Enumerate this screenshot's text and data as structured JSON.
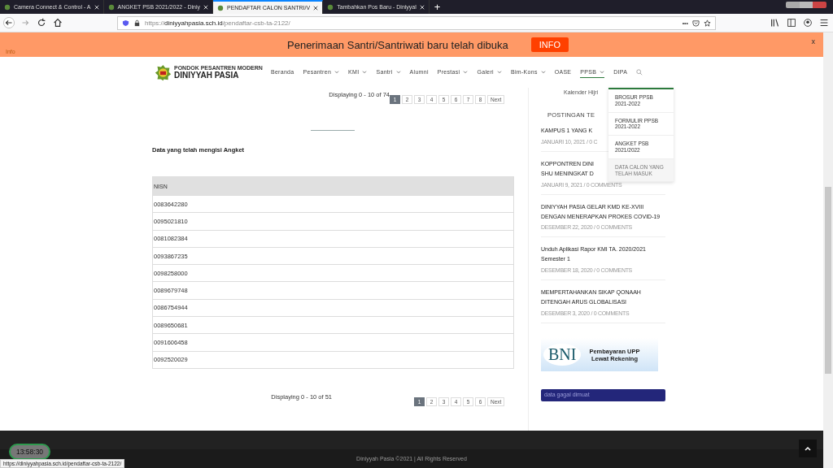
{
  "browser": {
    "tabs": [
      {
        "title": "Camera Connect & Control - A",
        "selected": false
      },
      {
        "title": "ANGKET PSB 2021/2022 - Diniy",
        "selected": false
      },
      {
        "title": "PENDAFTAR CALON SANTRI/V",
        "selected": true
      },
      {
        "title": "Tambahkan Pos Baru - Diniyyal",
        "selected": false
      }
    ],
    "new_tab": "+",
    "url_host": "diniyyahpasia.sch.id",
    "url_prefix": "https://",
    "url_path": "/pendaftar-csb-ta-2122/",
    "url_more": "•••"
  },
  "banner": {
    "label": "Info",
    "message": "Penerimaan Santri/Santriwati baru telah dibuka",
    "button": "INFO",
    "close": "x"
  },
  "site": {
    "logo_small": "PONDOK PESANTREN MODERN",
    "logo_big": "DINIYYAH PASIA",
    "nav": [
      {
        "label": "Beranda",
        "dropdown": false,
        "selected": false
      },
      {
        "label": "Pesantren",
        "dropdown": true,
        "selected": false
      },
      {
        "label": "KMI",
        "dropdown": true,
        "selected": false
      },
      {
        "label": "Santri",
        "dropdown": true,
        "selected": false
      },
      {
        "label": "Alumni",
        "dropdown": false,
        "selected": false
      },
      {
        "label": "Prestasi",
        "dropdown": true,
        "selected": false
      },
      {
        "label": "Galeri",
        "dropdown": true,
        "selected": false
      },
      {
        "label": "Bim-Kons",
        "dropdown": true,
        "selected": false
      },
      {
        "label": "OASE",
        "dropdown": false,
        "selected": false
      },
      {
        "label": "PPSB",
        "dropdown": true,
        "selected": true
      },
      {
        "label": "DIPA",
        "dropdown": false,
        "selected": false
      }
    ],
    "submenu": [
      {
        "label": "BROSUR PPSB 2021-2022",
        "selected": false
      },
      {
        "label": "FORMULIR PPSB 2021-2022",
        "selected": false
      },
      {
        "label": "ANGKET PSB 2021/2022",
        "selected": false
      },
      {
        "label": "DATA CALON YANG TELAH MASUK",
        "selected": true
      }
    ]
  },
  "main": {
    "pager_top": {
      "info": "Displaying 0 - 10 of 74",
      "pages": [
        {
          "label": "1",
          "selected": true
        },
        {
          "label": "2",
          "selected": false
        },
        {
          "label": "3",
          "selected": false
        },
        {
          "label": "4",
          "selected": false
        },
        {
          "label": "5",
          "selected": false
        },
        {
          "label": "6",
          "selected": false
        },
        {
          "label": "7",
          "selected": false
        },
        {
          "label": "8",
          "selected": false
        },
        {
          "label": "Next",
          "selected": false
        }
      ]
    },
    "heading": "Data yang telah mengisi Angket",
    "table": {
      "columns": [
        "NISN"
      ],
      "rows": [
        "0083642280",
        "0095021810",
        "0081082384",
        "0093867235",
        "0098258000",
        "0089679748",
        "0086754944",
        "0089650681",
        "0091606458",
        "0092520029"
      ]
    },
    "pager_bottom": {
      "info": "Displaying 0 - 10 of 51",
      "pages": [
        {
          "label": "1",
          "selected": true
        },
        {
          "label": "2",
          "selected": false
        },
        {
          "label": "3",
          "selected": false
        },
        {
          "label": "4",
          "selected": false
        },
        {
          "label": "5",
          "selected": false
        },
        {
          "label": "6",
          "selected": false
        },
        {
          "label": "Next",
          "selected": false
        }
      ]
    }
  },
  "sidebar": {
    "calendar_caption": "Kalender Hijri",
    "posts_title": "POSTINGAN TE",
    "posts": [
      {
        "title": "KAMPUS 1 YANG K",
        "meta": "JANUARI 10, 2021 / 0 C"
      },
      {
        "title": "KOPPONTREN DINI SHU MENINGKAT D",
        "meta": "JANUARI 9, 2021 / 0 COMMENTS"
      },
      {
        "title": "DINIYYAH PASIA GELAR KMD KE-XVIII DENGAN MENERAPKAN PROKES COVID-19",
        "meta": "DESEMBER 22, 2020 / 0 COMMENTS"
      },
      {
        "title": "Unduh Aplikasi Rapor KMI TA. 2020/2021 Semester 1",
        "meta": "DESEMBER 18, 2020 / 0 COMMENTS"
      },
      {
        "title": "MEMPERTAHANKAN SIKAP QONAAH DITENGAH ARUS GLOBALISASI",
        "meta": "DESEMBER 3, 2020 / 0 COMMENTS"
      }
    ],
    "bni": {
      "logo": "BNI",
      "text": "Pembayaran UPP Lewat Rekening"
    },
    "notice": "data gagal dimuat"
  },
  "footer": {
    "copyright": "Diniyyah Pasia ©2021 | All Rights Reserved"
  },
  "clock": "13:58:30",
  "status_url": "https://diniyyahpasia.sch.id/pendaftar-csb-ta-2122/"
}
